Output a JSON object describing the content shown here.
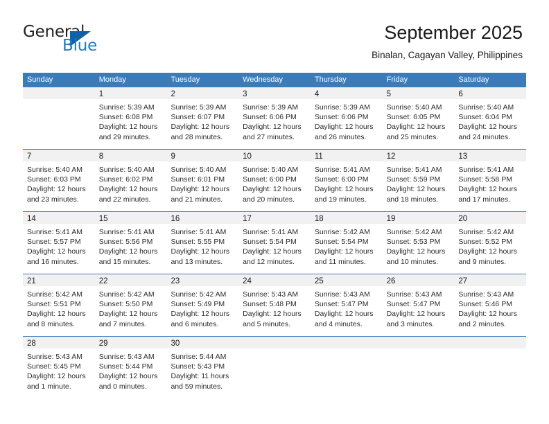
{
  "brand": {
    "name_part1": "General",
    "name_part2": "Blue"
  },
  "header": {
    "title": "September 2025",
    "subtitle": "Binalan, Cagayan Valley, Philippines"
  },
  "calendar": {
    "weekday_headers": [
      "Sunday",
      "Monday",
      "Tuesday",
      "Wednesday",
      "Thursday",
      "Friday",
      "Saturday"
    ],
    "colors": {
      "header_blue": "#3b7cb8",
      "daynum_band": "#f1f1f1",
      "brand_blue": "#1f7ac4",
      "text": "#1a1a1a"
    },
    "weeks": [
      [
        {
          "day": "",
          "sunrise": "",
          "sunset": "",
          "daylight_line1": "",
          "daylight_line2": ""
        },
        {
          "day": "1",
          "sunrise": "Sunrise: 5:39 AM",
          "sunset": "Sunset: 6:08 PM",
          "daylight_line1": "Daylight: 12 hours",
          "daylight_line2": "and 29 minutes."
        },
        {
          "day": "2",
          "sunrise": "Sunrise: 5:39 AM",
          "sunset": "Sunset: 6:07 PM",
          "daylight_line1": "Daylight: 12 hours",
          "daylight_line2": "and 28 minutes."
        },
        {
          "day": "3",
          "sunrise": "Sunrise: 5:39 AM",
          "sunset": "Sunset: 6:06 PM",
          "daylight_line1": "Daylight: 12 hours",
          "daylight_line2": "and 27 minutes."
        },
        {
          "day": "4",
          "sunrise": "Sunrise: 5:39 AM",
          "sunset": "Sunset: 6:06 PM",
          "daylight_line1": "Daylight: 12 hours",
          "daylight_line2": "and 26 minutes."
        },
        {
          "day": "5",
          "sunrise": "Sunrise: 5:40 AM",
          "sunset": "Sunset: 6:05 PM",
          "daylight_line1": "Daylight: 12 hours",
          "daylight_line2": "and 25 minutes."
        },
        {
          "day": "6",
          "sunrise": "Sunrise: 5:40 AM",
          "sunset": "Sunset: 6:04 PM",
          "daylight_line1": "Daylight: 12 hours",
          "daylight_line2": "and 24 minutes."
        }
      ],
      [
        {
          "day": "7",
          "sunrise": "Sunrise: 5:40 AM",
          "sunset": "Sunset: 6:03 PM",
          "daylight_line1": "Daylight: 12 hours",
          "daylight_line2": "and 23 minutes."
        },
        {
          "day": "8",
          "sunrise": "Sunrise: 5:40 AM",
          "sunset": "Sunset: 6:02 PM",
          "daylight_line1": "Daylight: 12 hours",
          "daylight_line2": "and 22 minutes."
        },
        {
          "day": "9",
          "sunrise": "Sunrise: 5:40 AM",
          "sunset": "Sunset: 6:01 PM",
          "daylight_line1": "Daylight: 12 hours",
          "daylight_line2": "and 21 minutes."
        },
        {
          "day": "10",
          "sunrise": "Sunrise: 5:40 AM",
          "sunset": "Sunset: 6:00 PM",
          "daylight_line1": "Daylight: 12 hours",
          "daylight_line2": "and 20 minutes."
        },
        {
          "day": "11",
          "sunrise": "Sunrise: 5:41 AM",
          "sunset": "Sunset: 6:00 PM",
          "daylight_line1": "Daylight: 12 hours",
          "daylight_line2": "and 19 minutes."
        },
        {
          "day": "12",
          "sunrise": "Sunrise: 5:41 AM",
          "sunset": "Sunset: 5:59 PM",
          "daylight_line1": "Daylight: 12 hours",
          "daylight_line2": "and 18 minutes."
        },
        {
          "day": "13",
          "sunrise": "Sunrise: 5:41 AM",
          "sunset": "Sunset: 5:58 PM",
          "daylight_line1": "Daylight: 12 hours",
          "daylight_line2": "and 17 minutes."
        }
      ],
      [
        {
          "day": "14",
          "sunrise": "Sunrise: 5:41 AM",
          "sunset": "Sunset: 5:57 PM",
          "daylight_line1": "Daylight: 12 hours",
          "daylight_line2": "and 16 minutes."
        },
        {
          "day": "15",
          "sunrise": "Sunrise: 5:41 AM",
          "sunset": "Sunset: 5:56 PM",
          "daylight_line1": "Daylight: 12 hours",
          "daylight_line2": "and 15 minutes."
        },
        {
          "day": "16",
          "sunrise": "Sunrise: 5:41 AM",
          "sunset": "Sunset: 5:55 PM",
          "daylight_line1": "Daylight: 12 hours",
          "daylight_line2": "and 13 minutes."
        },
        {
          "day": "17",
          "sunrise": "Sunrise: 5:41 AM",
          "sunset": "Sunset: 5:54 PM",
          "daylight_line1": "Daylight: 12 hours",
          "daylight_line2": "and 12 minutes."
        },
        {
          "day": "18",
          "sunrise": "Sunrise: 5:42 AM",
          "sunset": "Sunset: 5:54 PM",
          "daylight_line1": "Daylight: 12 hours",
          "daylight_line2": "and 11 minutes."
        },
        {
          "day": "19",
          "sunrise": "Sunrise: 5:42 AM",
          "sunset": "Sunset: 5:53 PM",
          "daylight_line1": "Daylight: 12 hours",
          "daylight_line2": "and 10 minutes."
        },
        {
          "day": "20",
          "sunrise": "Sunrise: 5:42 AM",
          "sunset": "Sunset: 5:52 PM",
          "daylight_line1": "Daylight: 12 hours",
          "daylight_line2": "and 9 minutes."
        }
      ],
      [
        {
          "day": "21",
          "sunrise": "Sunrise: 5:42 AM",
          "sunset": "Sunset: 5:51 PM",
          "daylight_line1": "Daylight: 12 hours",
          "daylight_line2": "and 8 minutes."
        },
        {
          "day": "22",
          "sunrise": "Sunrise: 5:42 AM",
          "sunset": "Sunset: 5:50 PM",
          "daylight_line1": "Daylight: 12 hours",
          "daylight_line2": "and 7 minutes."
        },
        {
          "day": "23",
          "sunrise": "Sunrise: 5:42 AM",
          "sunset": "Sunset: 5:49 PM",
          "daylight_line1": "Daylight: 12 hours",
          "daylight_line2": "and 6 minutes."
        },
        {
          "day": "24",
          "sunrise": "Sunrise: 5:43 AM",
          "sunset": "Sunset: 5:48 PM",
          "daylight_line1": "Daylight: 12 hours",
          "daylight_line2": "and 5 minutes."
        },
        {
          "day": "25",
          "sunrise": "Sunrise: 5:43 AM",
          "sunset": "Sunset: 5:47 PM",
          "daylight_line1": "Daylight: 12 hours",
          "daylight_line2": "and 4 minutes."
        },
        {
          "day": "26",
          "sunrise": "Sunrise: 5:43 AM",
          "sunset": "Sunset: 5:47 PM",
          "daylight_line1": "Daylight: 12 hours",
          "daylight_line2": "and 3 minutes."
        },
        {
          "day": "27",
          "sunrise": "Sunrise: 5:43 AM",
          "sunset": "Sunset: 5:46 PM",
          "daylight_line1": "Daylight: 12 hours",
          "daylight_line2": "and 2 minutes."
        }
      ],
      [
        {
          "day": "28",
          "sunrise": "Sunrise: 5:43 AM",
          "sunset": "Sunset: 5:45 PM",
          "daylight_line1": "Daylight: 12 hours",
          "daylight_line2": "and 1 minute."
        },
        {
          "day": "29",
          "sunrise": "Sunrise: 5:43 AM",
          "sunset": "Sunset: 5:44 PM",
          "daylight_line1": "Daylight: 12 hours",
          "daylight_line2": "and 0 minutes."
        },
        {
          "day": "30",
          "sunrise": "Sunrise: 5:44 AM",
          "sunset": "Sunset: 5:43 PM",
          "daylight_line1": "Daylight: 11 hours",
          "daylight_line2": "and 59 minutes."
        },
        {
          "day": "",
          "sunrise": "",
          "sunset": "",
          "daylight_line1": "",
          "daylight_line2": ""
        },
        {
          "day": "",
          "sunrise": "",
          "sunset": "",
          "daylight_line1": "",
          "daylight_line2": ""
        },
        {
          "day": "",
          "sunrise": "",
          "sunset": "",
          "daylight_line1": "",
          "daylight_line2": ""
        },
        {
          "day": "",
          "sunrise": "",
          "sunset": "",
          "daylight_line1": "",
          "daylight_line2": ""
        }
      ]
    ]
  }
}
